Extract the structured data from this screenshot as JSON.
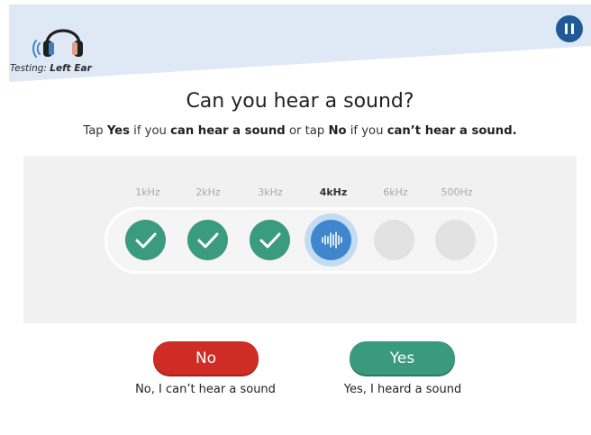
{
  "header": {
    "ear_prefix": "Testing: ",
    "ear_value": "Left Ear",
    "pause_icon": "pause-icon",
    "headphones_icon": "headphones-icon",
    "band_color": "#dfe9f6"
  },
  "main": {
    "title": "Can you hear a sound?",
    "instruction": {
      "p1": "Tap ",
      "b1": "Yes",
      "p2": " if you ",
      "b2": "can hear a sound",
      "p3": " or tap ",
      "b3": "No",
      "p4": " if you ",
      "b4": "can’t hear a sound."
    }
  },
  "test": {
    "frequencies": [
      {
        "label": "1kHz",
        "status": "done"
      },
      {
        "label": "2kHz",
        "status": "done"
      },
      {
        "label": "3kHz",
        "status": "done"
      },
      {
        "label": "4kHz",
        "status": "current"
      },
      {
        "label": "6kHz",
        "status": "pending"
      },
      {
        "label": "500Hz",
        "status": "pending"
      }
    ]
  },
  "responses": {
    "no_label": "No",
    "no_caption": "No, I can’t hear a sound",
    "yes_label": "Yes",
    "yes_caption": "Yes, I heard a sound"
  },
  "colors": {
    "accent_blue": "#1f5a97",
    "done_green": "#3b9b7e",
    "no_red": "#cf2c26",
    "current_blue": "#3f86cc"
  }
}
